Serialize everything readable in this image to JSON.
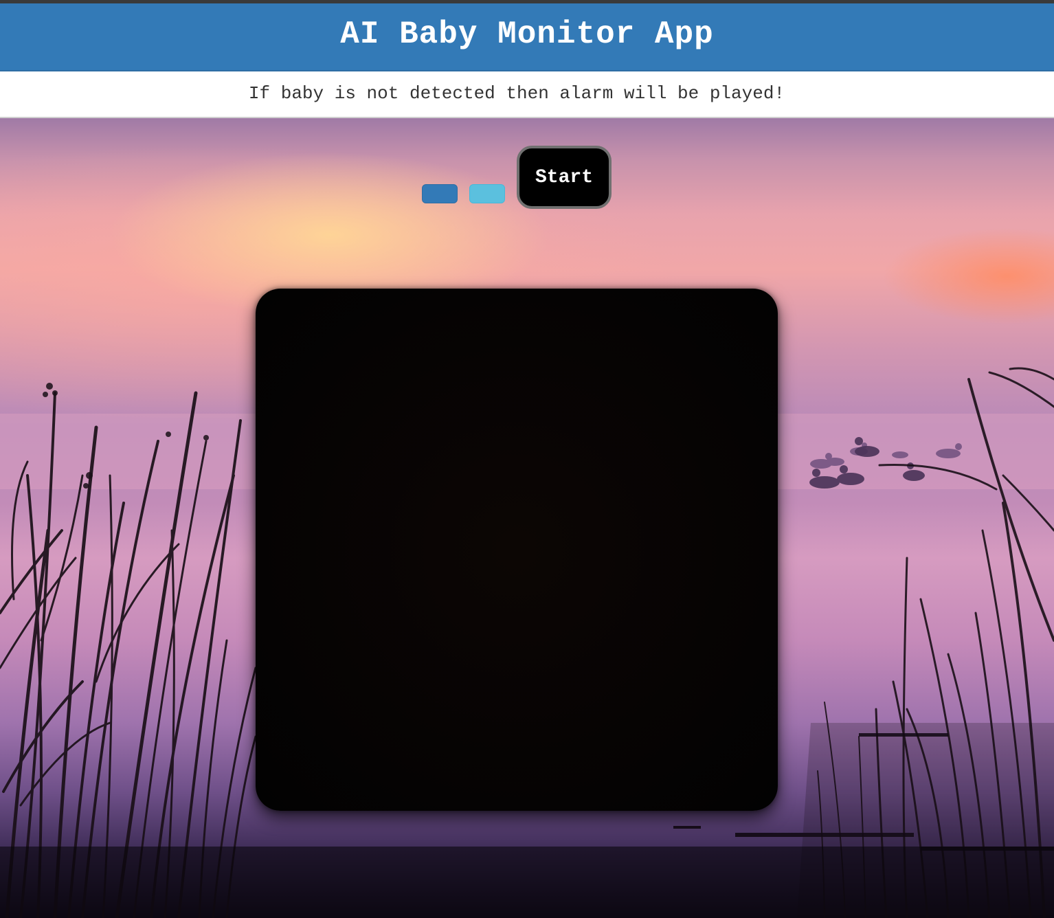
{
  "header": {
    "title": "AI Baby Monitor App"
  },
  "subtitle": {
    "text": "If baby is not detected then alarm will be played!"
  },
  "controls": {
    "start_label": "Start",
    "small_button_1_color": "#337ab7",
    "small_button_2_color": "#5bc0de"
  },
  "video": {
    "state": "blank"
  },
  "background": {
    "scene": "misty pink lake at sunrise with reed silhouettes and ducks"
  }
}
